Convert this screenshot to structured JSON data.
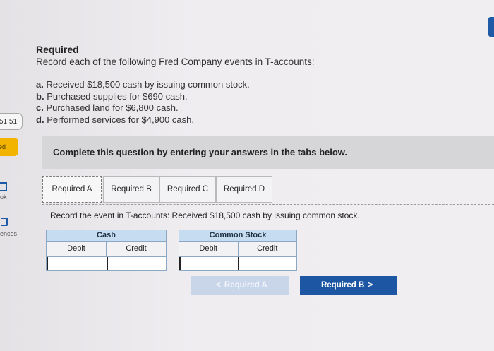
{
  "sidebar": {
    "timer_text": "51:51",
    "status_text": "ed",
    "ebook_label": "ok",
    "references_label": "ences"
  },
  "question": {
    "title": "Required",
    "instruction": "Record each of the following Fred Company events in T-accounts:",
    "events": [
      {
        "letter": "a.",
        "text": "Received $18,500 cash by issuing common stock."
      },
      {
        "letter": "b.",
        "text": "Purchased supplies for $690 cash."
      },
      {
        "letter": "c.",
        "text": "Purchased land for $6,800 cash."
      },
      {
        "letter": "d.",
        "text": "Performed services for $4,900 cash."
      }
    ]
  },
  "banner": {
    "text": "Complete this question by entering your answers in the tabs below."
  },
  "tabs": [
    {
      "label": "Required A",
      "active": true
    },
    {
      "label": "Required B",
      "active": false
    },
    {
      "label": "Required C",
      "active": false
    },
    {
      "label": "Required D",
      "active": false
    }
  ],
  "prompt": "Record the event in T-accounts: Received $18,500 cash by issuing common stock.",
  "t_accounts": [
    {
      "name": "Cash",
      "debit_label": "Debit",
      "credit_label": "Credit",
      "debit_value": "",
      "credit_value": ""
    },
    {
      "name": "Common Stock",
      "debit_label": "Debit",
      "credit_label": "Credit",
      "debit_value": "",
      "credit_value": ""
    }
  ],
  "nav": {
    "prev_label": "Required A",
    "next_label": "Required B",
    "prev_chevron": "<",
    "next_chevron": ">"
  },
  "colors": {
    "accent": "#1d56a3",
    "header_fill": "#c6ddf1",
    "status": "#f2b400"
  }
}
